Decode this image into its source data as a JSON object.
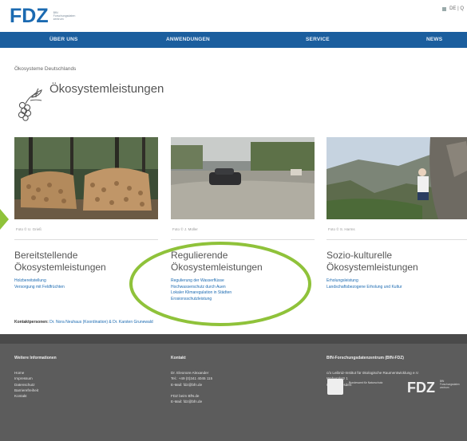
{
  "header": {
    "logo": "FDZ",
    "logo_sub": "BfN Forschungsdaten zentrum",
    "utility": "DE  |  Q"
  },
  "nav": {
    "items": [
      "ÜBER UNS",
      "ANWENDUNGEN",
      "SERVICE",
      "NEWS"
    ]
  },
  "breadcrumb": "Ökosysteme Deutschlands",
  "page": {
    "title": "Ökosystemleistungen"
  },
  "columns": [
    {
      "caption": "Foto © U. Grieß",
      "title_line1": "Bereitstellende",
      "title_line2": "Ökosystemleistungen",
      "links": [
        "Holzbereitstellung",
        "Versorgung mit Feldfrüchten"
      ]
    },
    {
      "caption": "Foto © J. Müller",
      "title_line1": "Regulierende",
      "title_line2": "Ökosystemleistungen",
      "links": [
        "Regulierung der Wasserflüsse",
        "Hochwasserschutz durch Auen",
        "Lokaler Klimaregulation in Städten",
        "Erosionsschutzleistung"
      ]
    },
    {
      "caption": "Foto © S. Harms",
      "title_line1": "Sozio-kulturelle",
      "title_line2": "Ökosystemleistungen",
      "links": [
        "Erholungsleistung",
        "Landschaftsbezogene Erholung und Kultur"
      ]
    }
  ],
  "contact": {
    "label": "Kontaktpersonen:",
    "text": "Dr. Nora Neuhaus (Koordination) & Dr. Karsten Grunewald"
  },
  "footer": {
    "col1": {
      "heading": "Weitere Informationen",
      "items": [
        "Home",
        "Impressum",
        "Datenschutz",
        "Barrierefreiheit",
        "Kontakt"
      ]
    },
    "col2": {
      "heading": "Kontakt",
      "items": [
        "Dr. Eleonore Alexander",
        "Tel.: +49 (0)341 4045 115",
        "E-Mail: fdz@bfn.de",
        "",
        "FDZ beim BfN.de",
        "E-Mail: fdz@bfn.de"
      ]
    },
    "col3": {
      "heading": "BfN-Forschungsdatenzentrum (BfN-FDZ)",
      "items": [
        "c/o Leibniz-Institut für ökologische Raumentwicklung e.V.",
        "Weberplatz 1",
        "01217 Dresden"
      ]
    },
    "logo_text": "FDZ",
    "partner_text": "Bundesamt für Naturschutz"
  },
  "colors": {
    "nav_bg": "#1b5e9e",
    "link": "#1b6ab1",
    "highlight": "#8fc23a",
    "footer_bg": "#5c5c5c"
  }
}
